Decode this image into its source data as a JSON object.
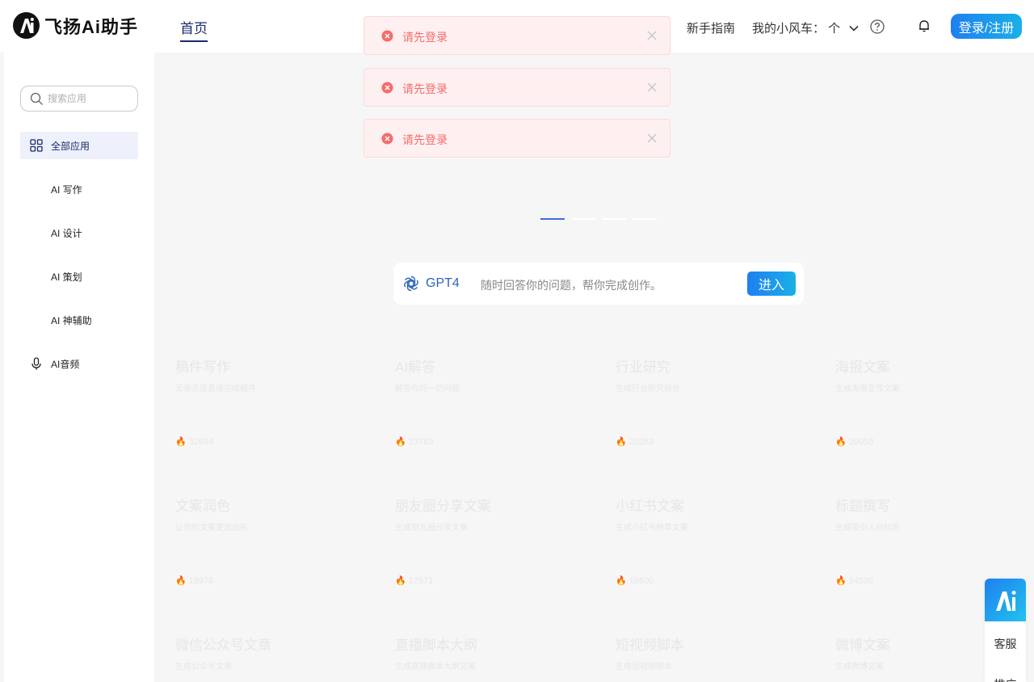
{
  "header": {
    "logo_text": "飞扬Ai助手",
    "nav_home": "首页",
    "nav_guide": "新手指南",
    "nav_car": "我的小风车： 个",
    "login_button": "登录/注册"
  },
  "sidebar": {
    "search_placeholder": "搜索应用",
    "items": [
      {
        "label": "全部应用",
        "icon": "grid-icon"
      },
      {
        "label": "AI 写作"
      },
      {
        "label": "AI 设计"
      },
      {
        "label": "AI 策划"
      },
      {
        "label": "AI 神辅助"
      },
      {
        "label": "AI音频",
        "icon": "microphone-icon"
      }
    ]
  },
  "toasts": [
    {
      "message": "请先登录"
    },
    {
      "message": "请先登录"
    },
    {
      "message": "请先登录"
    }
  ],
  "gpt": {
    "name": "GPT4",
    "description": "随时回答你的问题，帮你完成创作。",
    "enter_button": "进入"
  },
  "cards": [
    {
      "title": "稿件写作",
      "desc": "无需灵感直接完成稿件",
      "count": "32694"
    },
    {
      "title": "AI解答",
      "desc": "解答你的一切问题",
      "count": "23763"
    },
    {
      "title": "行业研究",
      "desc": "生成行业研究报告",
      "count": "20283"
    },
    {
      "title": "海报文案",
      "desc": "生成海报宣传文案",
      "count": "20053"
    },
    {
      "title": "文案润色",
      "desc": "让你的文案更加出彩",
      "count": "18978"
    },
    {
      "title": "朋友圈分享文案",
      "desc": "生成朋友圈分享文案",
      "count": "17571"
    },
    {
      "title": "小红书文案",
      "desc": "生成小红书种草文案",
      "count": "16600"
    },
    {
      "title": "标题撰写",
      "desc": "生成吸引人的标题",
      "count": "14535"
    },
    {
      "title": "微信公众号文章",
      "desc": "生成公众号文章",
      "count": ""
    },
    {
      "title": "直播脚本大纲",
      "desc": "生成直播脚本大纲文案",
      "count": ""
    },
    {
      "title": "短视频脚本",
      "desc": "生成短视频脚本",
      "count": ""
    },
    {
      "title": "微博文案",
      "desc": "生成微博文案",
      "count": ""
    }
  ],
  "float_panel": {
    "kefu": "客服",
    "tuiguang": "推广"
  },
  "colors": {
    "accent": "#1e7ff0",
    "nav_active": "#1a2b6b",
    "error": "#f56c6c"
  }
}
